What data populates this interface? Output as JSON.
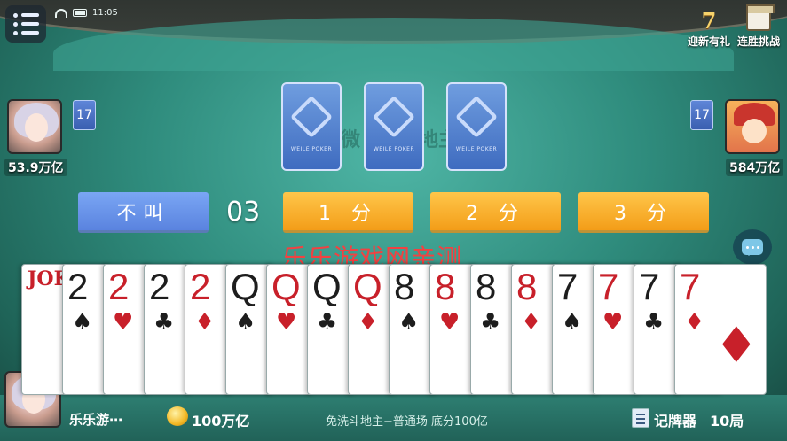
{
  "status": {
    "time": "11:05"
  },
  "top_right": [
    {
      "label": "迎新有礼",
      "icon": "seven-day-gift-icon",
      "icon_text": "7"
    },
    {
      "label": "连胜挑战",
      "icon": "mission-icon",
      "icon_text": "MISSION"
    }
  ],
  "players": {
    "left": {
      "card_count": "17",
      "coins": "53.9万亿",
      "avatar": "girl-avatar"
    },
    "right": {
      "card_count": "17",
      "coins": "584万亿",
      "avatar": "kid-avatar"
    }
  },
  "bottom_cards": [
    {
      "brand": "WEILE POKER"
    },
    {
      "brand": "WEILE POKER"
    },
    {
      "brand": "WEILE POKER"
    }
  ],
  "table_watermark": {
    "left": "微",
    "right": "地主"
  },
  "bidding": {
    "pass_label": "不叫",
    "timer": "03",
    "options": [
      "1 分",
      "2 分",
      "3 分"
    ]
  },
  "overlay_text": "乐乐游戏网亲测",
  "hand": [
    {
      "rank": "JOKER",
      "suit": "",
      "color": "red"
    },
    {
      "rank": "2",
      "suit": "♠",
      "color": "black"
    },
    {
      "rank": "2",
      "suit": "♥",
      "color": "red"
    },
    {
      "rank": "2",
      "suit": "♣",
      "color": "black"
    },
    {
      "rank": "2",
      "suit": "♦",
      "color": "red"
    },
    {
      "rank": "Q",
      "suit": "♠",
      "color": "black"
    },
    {
      "rank": "Q",
      "suit": "♥",
      "color": "red"
    },
    {
      "rank": "Q",
      "suit": "♣",
      "color": "black"
    },
    {
      "rank": "Q",
      "suit": "♦",
      "color": "red"
    },
    {
      "rank": "8",
      "suit": "♠",
      "color": "black"
    },
    {
      "rank": "8",
      "suit": "♥",
      "color": "red"
    },
    {
      "rank": "8",
      "suit": "♣",
      "color": "black"
    },
    {
      "rank": "8",
      "suit": "♦",
      "color": "red"
    },
    {
      "rank": "7",
      "suit": "♠",
      "color": "black"
    },
    {
      "rank": "7",
      "suit": "♥",
      "color": "red"
    },
    {
      "rank": "7",
      "suit": "♣",
      "color": "black"
    },
    {
      "rank": "7",
      "suit": "♦",
      "color": "red"
    }
  ],
  "me": {
    "name": "乐乐游⋯",
    "coins": "100万亿"
  },
  "room_info": "免洗斗地主−普通场 底分100亿",
  "record": {
    "label": "记牌器",
    "games": "10局"
  }
}
